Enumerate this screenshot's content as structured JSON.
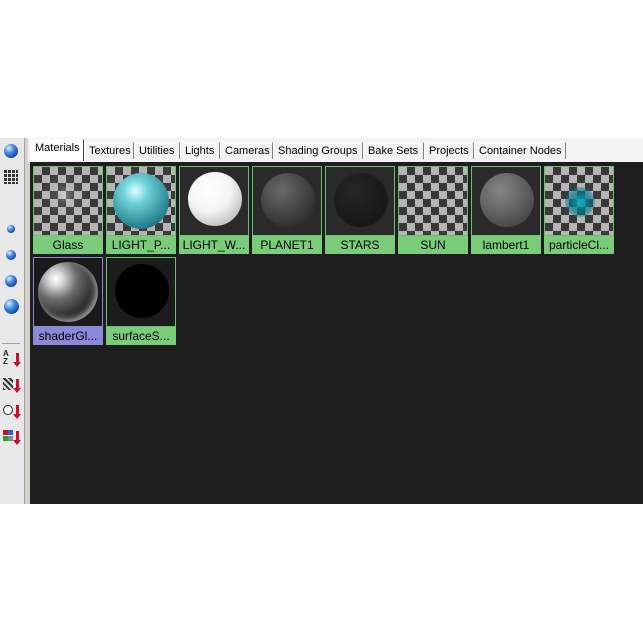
{
  "tabs": [
    {
      "label": "Materials",
      "active": true
    },
    {
      "label": "Textures"
    },
    {
      "label": "Utilities"
    },
    {
      "label": "Lights"
    },
    {
      "label": "Cameras"
    },
    {
      "label": "Shading Groups"
    },
    {
      "label": "Bake Sets"
    },
    {
      "label": "Projects"
    },
    {
      "label": "Container Nodes"
    }
  ],
  "toolbar": {
    "icons": [
      "sphere-large-icon",
      "grid-view-icon",
      "sphere-small-icon",
      "sphere-medium-icon",
      "sphere-large2-icon",
      "sphere-xlarge-icon",
      "sort-by-name-icon",
      "sort-by-type-icon",
      "sort-by-time-icon",
      "sort-reverse-icon"
    ]
  },
  "materials": [
    {
      "label": "Glass"
    },
    {
      "label": "LIGHT_P..."
    },
    {
      "label": "LIGHT_W..."
    },
    {
      "label": "PLANET1"
    },
    {
      "label": "STARS"
    },
    {
      "label": "SUN"
    },
    {
      "label": "lambert1"
    },
    {
      "label": "particleCl..."
    },
    {
      "label": "shaderGl...",
      "selected": true
    },
    {
      "label": "surfaceS..."
    }
  ],
  "colors": {
    "swatch_label_bg": "#7acc7a",
    "selected_label_bg": "#8a8ad8",
    "panel_bg": "#1e1e1e"
  }
}
